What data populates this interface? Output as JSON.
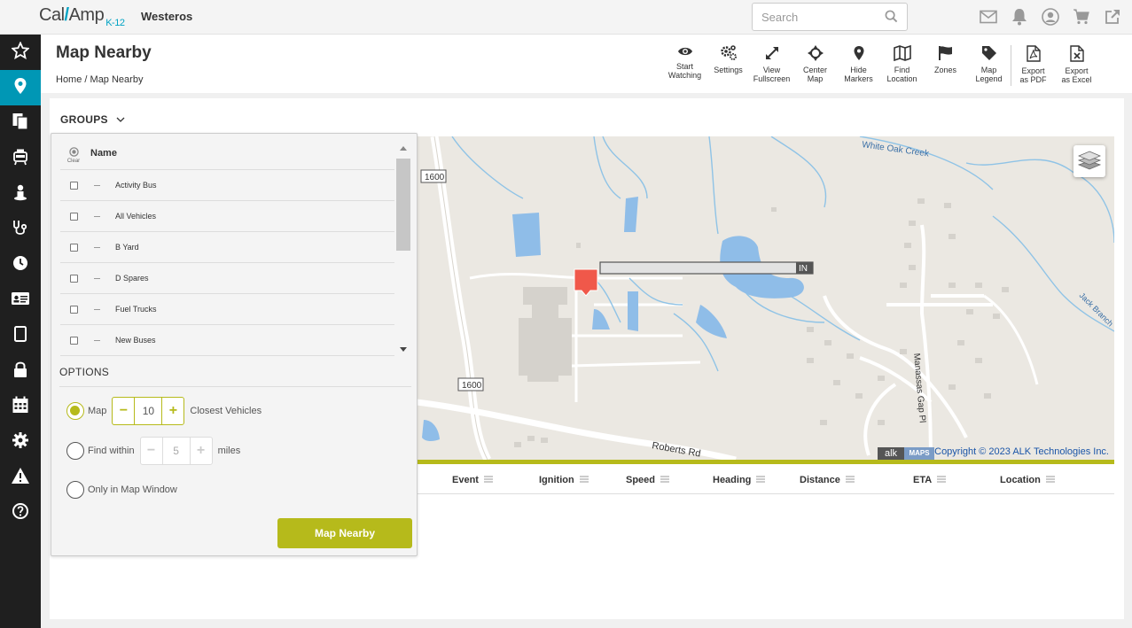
{
  "app": {
    "logo_text": "CalAmp",
    "logo_suffix": "K-12",
    "org": "Westeros"
  },
  "search": {
    "placeholder": "Search"
  },
  "top_icons": [
    "mail-icon",
    "bell-icon",
    "user-icon",
    "cart-icon",
    "external-link-icon"
  ],
  "nav": [
    "star-icon",
    "map-pin-icon",
    "documents-icon",
    "bus-icon",
    "driver-icon",
    "stethoscope-icon",
    "clock-icon",
    "id-card-icon",
    "tablet-icon",
    "lock-icon",
    "calendar-icon",
    "gear-icon",
    "warning-icon",
    "help-icon"
  ],
  "header": {
    "title": "Map Nearby",
    "breadcrumb_home": "Home",
    "breadcrumb_sep": "/",
    "breadcrumb_current": "Map Nearby"
  },
  "toolbar": [
    {
      "label": "Start\nWatching",
      "icon": "eye-icon"
    },
    {
      "label": "Settings",
      "icon": "settings-icon"
    },
    {
      "label": "View\nFullscreen",
      "icon": "fullscreen-icon"
    },
    {
      "label": "Center\nMap",
      "icon": "crosshair-icon"
    },
    {
      "label": "Hide\nMarkers",
      "icon": "marker-icon"
    },
    {
      "label": "Find\nLocation",
      "icon": "map-icon"
    },
    {
      "label": "Zones",
      "icon": "flag-icon"
    },
    {
      "label": "Map\nLegend",
      "icon": "tag-icon"
    },
    {
      "label": "Export\nas PDF",
      "icon": "pdf-icon"
    },
    {
      "label": "Export\nas Excel",
      "icon": "excel-icon"
    }
  ],
  "groups": {
    "title": "GROUPS",
    "clear_label": "Clear",
    "name_header": "Name",
    "items": [
      "Activity Bus",
      "All Vehicles",
      "B Yard",
      "D Spares",
      "Fuel Trucks",
      "New Buses"
    ]
  },
  "options": {
    "title": "OPTIONS",
    "map_label": "Map",
    "map_count": "10",
    "closest_label": "Closest Vehicles",
    "find_within_label": "Find within",
    "find_within_value": "5",
    "miles_label": "miles",
    "only_map_label": "Only in Map Window",
    "selected": "map",
    "submit_label": "Map Nearby"
  },
  "map": {
    "labels": {
      "road1": "1600",
      "road2": "1600",
      "roberts": "Roberts Rd",
      "creek": "White Oak Creek",
      "jack": "Jack Branch",
      "manassas": "Manassas Gap Pl",
      "marker_status": "IN"
    },
    "copyright": "Copyright © 2023 ALK Technologies Inc.",
    "alk_logo": "alk",
    "alk_maps": "MAPS",
    "accent_color": "#b6ba1b",
    "water_color": "#8fbde8"
  },
  "table": {
    "columns": [
      "Event",
      "Ignition",
      "Speed",
      "Heading",
      "Distance",
      "ETA",
      "Location"
    ]
  }
}
